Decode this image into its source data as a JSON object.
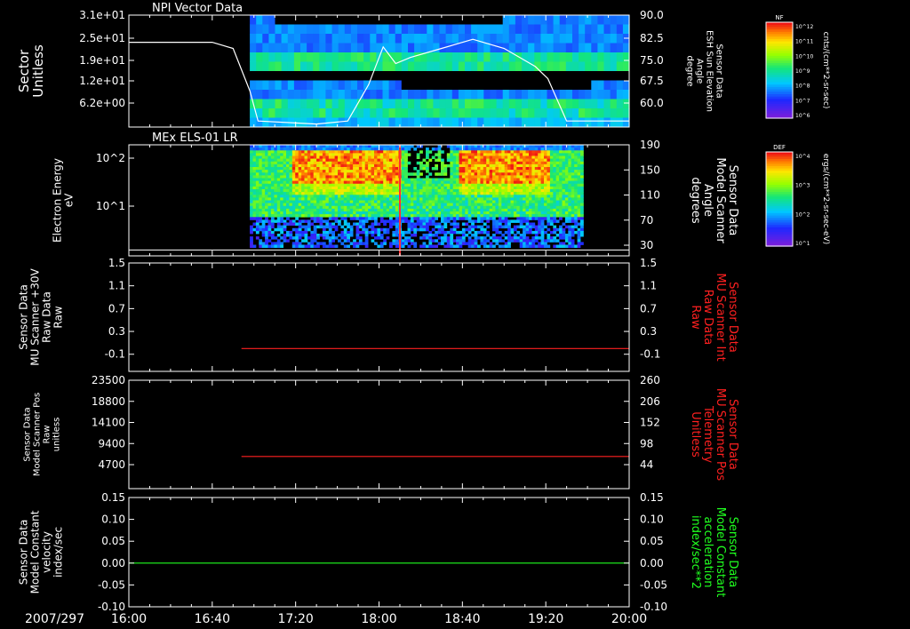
{
  "colors": {
    "background": "#000000",
    "axis": "#ffffff",
    "red_trace": "#ff2020",
    "green_trace": "#20ff20",
    "spectro_bg": "#1020b0"
  },
  "time_axis": {
    "date_label": "2007/297",
    "ticks": [
      "16:00",
      "16:40",
      "17:20",
      "18:00",
      "18:40",
      "19:20",
      "20:00"
    ]
  },
  "colorbars": [
    {
      "title": "NF",
      "units": "cnts/(cm**2-sr-sec)",
      "tick_labels": [
        "10^12",
        "10^11",
        "10^10",
        "10^9",
        "10^8",
        "10^7",
        "10^6"
      ]
    },
    {
      "title": "DEF",
      "units": "ergs/(cm**2-sr-sec-eV)",
      "tick_labels": [
        "10^4",
        "10^3",
        "10^2",
        "10^1"
      ]
    }
  ],
  "chart_data": [
    {
      "type": "heatmap",
      "title": "NPI Vector Data",
      "ylabel": "Sector\nUnitless",
      "yticks": [
        "3.1e+01",
        "2.5e+01",
        "1.9e+01",
        "1.2e+01",
        "6.2e+00"
      ],
      "ylim": [
        0,
        31
      ],
      "data_start": "16:58",
      "data_end": "20:00",
      "overlay": {
        "type": "line",
        "ylabel": "Sensor Data\nESH Sun Elevation\nAngle\ndegree",
        "yticks": [
          "90.0",
          "82.5",
          "75.0",
          "67.5",
          "60.0"
        ],
        "ylim": [
          53,
          90
        ],
        "x": [
          "16:00",
          "16:40",
          "16:50",
          "16:58",
          "17:02",
          "17:30",
          "17:45",
          "17:55",
          "18:02",
          "18:08",
          "18:15",
          "18:30",
          "18:45",
          "19:00",
          "19:15",
          "19:21",
          "19:30",
          "20:00"
        ],
        "y": [
          81,
          81,
          79,
          65,
          55,
          54,
          55,
          67,
          79.5,
          74,
          76,
          79,
          82,
          79,
          73,
          69,
          55,
          55
        ]
      }
    },
    {
      "type": "heatmap",
      "title": "MEx ELS-01 LR",
      "ylabel": "Electron Energy\neV",
      "yticks": [
        "10^2",
        "10^1"
      ],
      "log": true,
      "data_start": "16:58",
      "data_end": "19:38",
      "overlay": {
        "type": "line",
        "ylabel": "Sensor Data\nModel Scanner\nAngle\ndegrees",
        "yticks": [
          "190",
          "150",
          "110",
          "70",
          "30"
        ],
        "ylim": [
          0,
          190
        ],
        "x": [
          "16:00",
          "20:00"
        ],
        "y": [
          10,
          10
        ]
      }
    },
    {
      "type": "line",
      "ylabel": "Sensor Data\nMU Scanner +30V\nRaw Data\nRaw",
      "yticks": [
        "1.5",
        "1.1",
        "0.7",
        "0.3",
        "-0.1"
      ],
      "ylim": [
        -0.4,
        1.5
      ],
      "right_ylabel": "Sensor Data\nMU Scanner Int\nRaw Data\nRaw",
      "right_yticks": [
        "1.5",
        "1.1",
        "0.7",
        "0.3",
        "-0.1"
      ],
      "series": [
        {
          "name": "Sensor Data MU Scanner Int Raw Data",
          "x": [
            "16:54",
            "20:00"
          ],
          "y": [
            0.0,
            0.0
          ]
        }
      ]
    },
    {
      "type": "line",
      "ylabel": "Sensor Data\nModel Scanner Pos\nRaw\nunitless",
      "yticks": [
        "23500",
        "18800",
        "14100",
        "9400",
        "4700"
      ],
      "ylim": [
        0,
        23500
      ],
      "right_ylabel": "Sensor Data\nMU Scanner Pos\nTelemetry\nUnitless",
      "right_yticks": [
        "260",
        "206",
        "152",
        "98",
        "44"
      ],
      "series": [
        {
          "name": "Sensor Data MU Scanner Pos Telemetry",
          "x": [
            "16:54",
            "20:00"
          ],
          "y": [
            83,
            83
          ]
        }
      ]
    },
    {
      "type": "line",
      "ylabel": "Sensor Data\nModel Constant\nvelocity\nindex/sec",
      "yticks": [
        "0.15",
        "0.10",
        "0.05",
        "0.00",
        "-0.05",
        "-0.10"
      ],
      "ylim": [
        -0.1,
        0.15
      ],
      "right_ylabel": "Sensor Data\nModel Constant\nacceleration\nindex/sec**2",
      "right_yticks": [
        "0.15",
        "0.10",
        "0.05",
        "0.00",
        "-0.05",
        "-0.10"
      ],
      "series": [
        {
          "name": "Sensor Data Model Constant acceleration",
          "x": [
            "16:00",
            "20:00"
          ],
          "y": [
            0.0,
            0.0
          ]
        }
      ]
    }
  ]
}
